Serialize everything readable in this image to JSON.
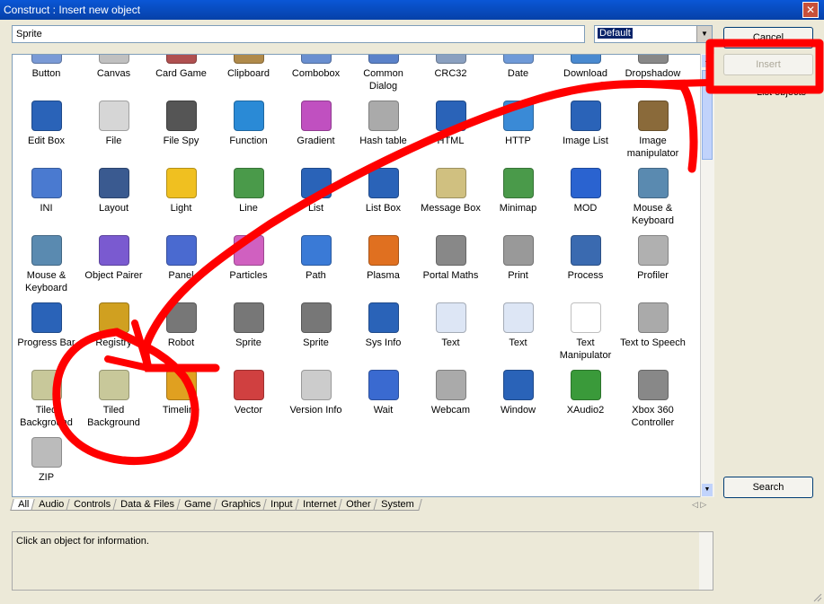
{
  "window": {
    "title": "Construct : Insert new object",
    "close": "✕"
  },
  "search": {
    "value": "Sprite"
  },
  "combo": {
    "value": "Default"
  },
  "buttons": {
    "cancel": "Cancel",
    "insert": "Insert",
    "list_objects": "List objects",
    "search": "Search"
  },
  "items": [
    {
      "label": "Button",
      "icon": "button-icon",
      "color": "#7a9ad6"
    },
    {
      "label": "Canvas",
      "icon": "canvas-icon",
      "color": "#c0c0c0"
    },
    {
      "label": "Card Game",
      "icon": "card-game-icon",
      "color": "#b05050"
    },
    {
      "label": "Clipboard",
      "icon": "clipboard-icon",
      "color": "#b08a4a"
    },
    {
      "label": "Combobox",
      "icon": "combobox-icon",
      "color": "#6a8fd0"
    },
    {
      "label": "Common Dialog",
      "icon": "common-dialog-icon",
      "color": "#5b82c9"
    },
    {
      "label": "CRC32",
      "icon": "crc32-icon",
      "color": "#8aa0c0"
    },
    {
      "label": "Date",
      "icon": "date-icon",
      "color": "#6f9ad8"
    },
    {
      "label": "Download",
      "icon": "download-icon",
      "color": "#4a8ad0"
    },
    {
      "label": "Dropshadow",
      "icon": "dropshadow-icon",
      "color": "#888888"
    },
    {
      "label": "Edit Box",
      "icon": "edit-box-icon",
      "color": "#2a63b8"
    },
    {
      "label": "File",
      "icon": "file-icon",
      "color": "#d6d6d6"
    },
    {
      "label": "File Spy",
      "icon": "file-spy-icon",
      "color": "#555555"
    },
    {
      "label": "Function",
      "icon": "function-icon",
      "color": "#2a8ad6"
    },
    {
      "label": "Gradient",
      "icon": "gradient-icon",
      "color": "#c050c0"
    },
    {
      "label": "Hash table",
      "icon": "hash-table-icon",
      "color": "#aaaaaa"
    },
    {
      "label": "HTML",
      "icon": "html-icon",
      "color": "#2a63b8"
    },
    {
      "label": "HTTP",
      "icon": "http-icon",
      "color": "#3a8ad6"
    },
    {
      "label": "Image List",
      "icon": "image-list-icon",
      "color": "#2a63b8"
    },
    {
      "label": "Image manipulator",
      "icon": "image-manipulator-icon",
      "color": "#8a6a3a"
    },
    {
      "label": "INI",
      "icon": "ini-icon",
      "color": "#4a7ad0"
    },
    {
      "label": "Layout",
      "icon": "layout-icon",
      "color": "#3a5a90"
    },
    {
      "label": "Light",
      "icon": "light-icon",
      "color": "#f0c020"
    },
    {
      "label": "Line",
      "icon": "line-icon",
      "color": "#4a9a4a"
    },
    {
      "label": "List",
      "icon": "list-icon",
      "color": "#2a63b8"
    },
    {
      "label": "List Box",
      "icon": "list-box-icon",
      "color": "#2a63b8"
    },
    {
      "label": "Message Box",
      "icon": "message-box-icon",
      "color": "#d0c080"
    },
    {
      "label": "Minimap",
      "icon": "minimap-icon",
      "color": "#4a9a4a"
    },
    {
      "label": "MOD",
      "icon": "mod-icon",
      "color": "#2a63d0"
    },
    {
      "label": "Mouse & Keyboard",
      "icon": "mouse-keyboard-icon",
      "color": "#5a8ab0"
    },
    {
      "label": "Mouse & Keyboard",
      "icon": "mouse-keyboard-icon",
      "color": "#5a8ab0"
    },
    {
      "label": "Object Pairer",
      "icon": "object-pairer-icon",
      "color": "#7a5ad0"
    },
    {
      "label": "Panel",
      "icon": "panel-icon",
      "color": "#4a6ad0"
    },
    {
      "label": "Particles",
      "icon": "particles-icon",
      "color": "#d060c0"
    },
    {
      "label": "Path",
      "icon": "path-icon",
      "color": "#3a7ad6"
    },
    {
      "label": "Plasma",
      "icon": "plasma-icon",
      "color": "#e07020"
    },
    {
      "label": "Portal Maths",
      "icon": "portal-maths-icon",
      "color": "#888888"
    },
    {
      "label": "Print",
      "icon": "print-icon",
      "color": "#999999"
    },
    {
      "label": "Process",
      "icon": "process-icon",
      "color": "#3a6ab0"
    },
    {
      "label": "Profiler",
      "icon": "profiler-icon",
      "color": "#b0b0b0"
    },
    {
      "label": "Progress Bar",
      "icon": "progress-bar-icon",
      "color": "#2a63b8"
    },
    {
      "label": "Registry",
      "icon": "registry-icon",
      "color": "#d0a020"
    },
    {
      "label": "Robot",
      "icon": "robot-icon",
      "color": "#777777"
    },
    {
      "label": "Sprite",
      "icon": "sprite-icon",
      "color": "#777777"
    },
    {
      "label": "Sprite",
      "icon": "sprite-icon",
      "color": "#777777"
    },
    {
      "label": "Sys Info",
      "icon": "sys-info-icon",
      "color": "#2a63b8"
    },
    {
      "label": "Text",
      "icon": "text-icon",
      "color": "#dde6f5"
    },
    {
      "label": "Text",
      "icon": "text-icon",
      "color": "#dde6f5"
    },
    {
      "label": "Text Manipulator",
      "icon": "text-manipulator-icon",
      "color": "#ffffff"
    },
    {
      "label": "Text to Speech",
      "icon": "text-to-speech-icon",
      "color": "#aaaaaa"
    },
    {
      "label": "Tiled Background",
      "icon": "tiled-background-icon",
      "color": "#c8c89a"
    },
    {
      "label": "Tiled Background",
      "icon": "tiled-background-icon",
      "color": "#c8c89a"
    },
    {
      "label": "Timeline",
      "icon": "timeline-icon",
      "color": "#e0a020"
    },
    {
      "label": "Vector",
      "icon": "vector-icon",
      "color": "#d04040"
    },
    {
      "label": "Version Info",
      "icon": "version-info-icon",
      "color": "#cccccc"
    },
    {
      "label": "Wait",
      "icon": "wait-icon",
      "color": "#3a6ad0"
    },
    {
      "label": "Webcam",
      "icon": "webcam-icon",
      "color": "#aaaaaa"
    },
    {
      "label": "Window",
      "icon": "window-icon",
      "color": "#2a63b8"
    },
    {
      "label": "XAudio2",
      "icon": "xaudio2-icon",
      "color": "#3a9a3a"
    },
    {
      "label": "Xbox 360 Controller",
      "icon": "xbox-controller-icon",
      "color": "#888888"
    },
    {
      "label": "ZIP",
      "icon": "zip-icon",
      "color": "#bbbbbb"
    }
  ],
  "tabs": [
    "All",
    "Audio",
    "Controls",
    "Data & Files",
    "Game",
    "Graphics",
    "Input",
    "Internet",
    "Other",
    "System"
  ],
  "tab_nav": "◁ ▷",
  "info": {
    "text": "Click an object for information."
  },
  "annotation": {
    "color": "#ff0000"
  }
}
